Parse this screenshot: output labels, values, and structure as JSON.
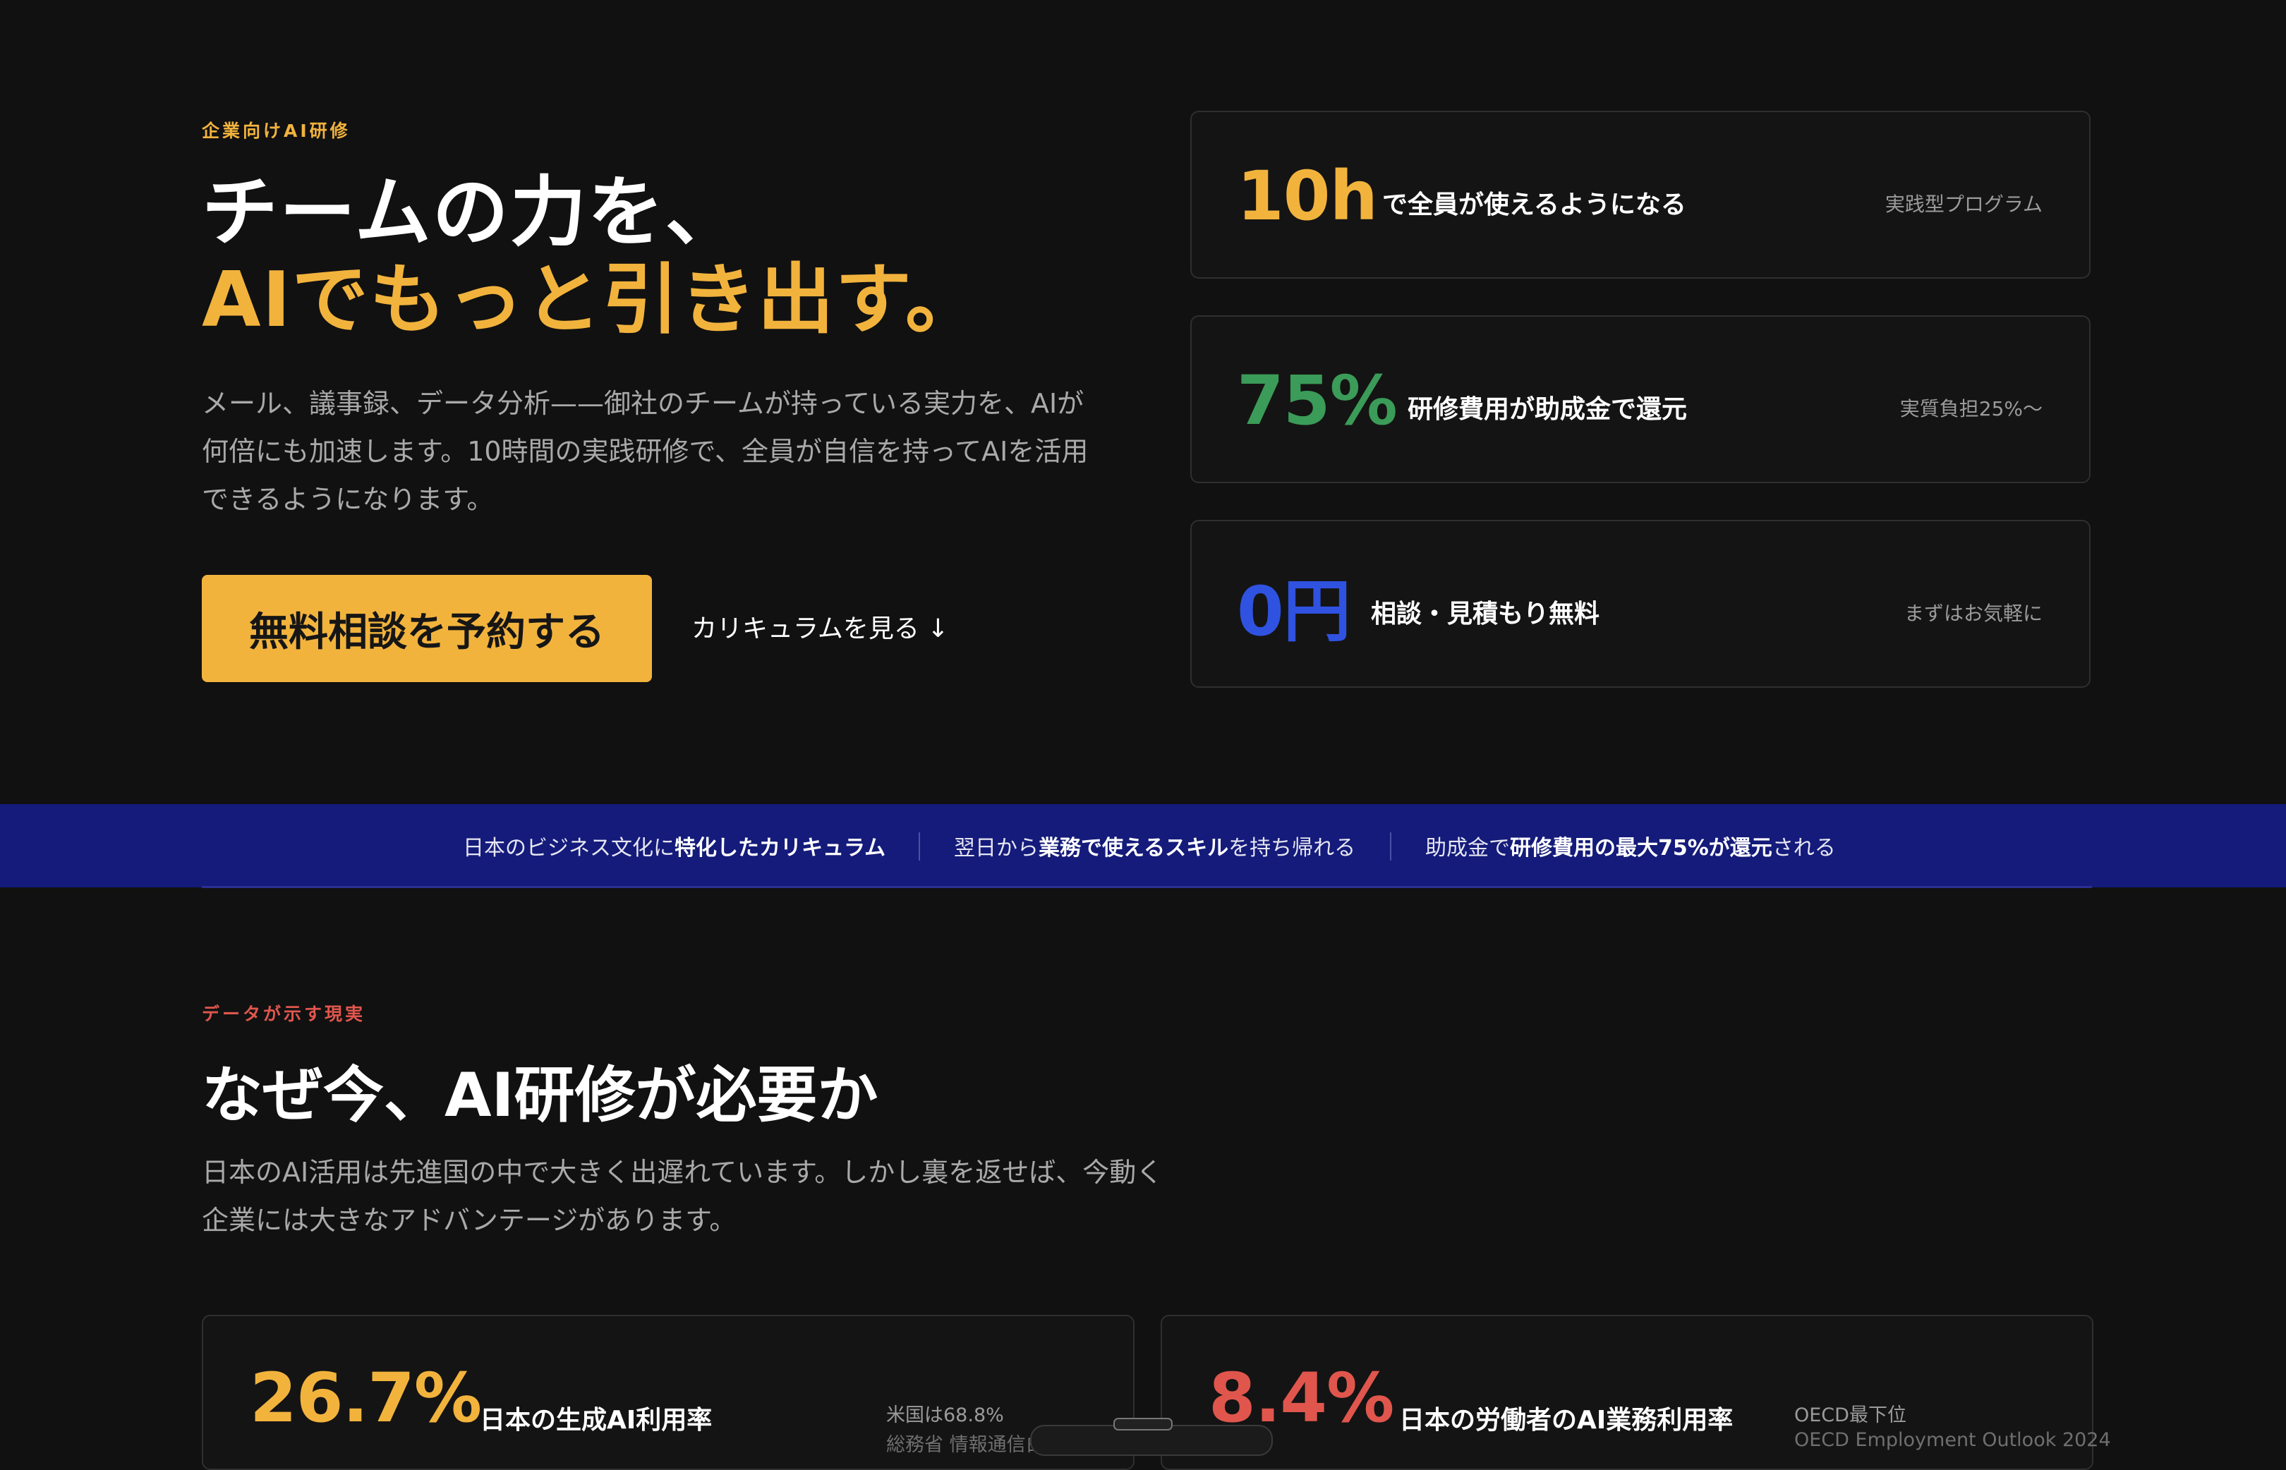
{
  "hero": {
    "eyebrow": "企業向けAI研修",
    "title_line1": "チームの力を、",
    "title_line2": "AIでもっと引き出す。",
    "lead": "メール、議事録、データ分析——御社のチームが持っている実力を、AIが何倍にも加速します。10時間の実践研修で、全員が自信を持ってAIを活用できるようになります。",
    "cta_label": "無料相談を予約する",
    "curriculum_link": "カリキュラムを見る ↓"
  },
  "stats": [
    {
      "value": "10h",
      "desc": "で全員が使えるようになる",
      "note": "実践型プログラム",
      "color": "#f2b33d"
    },
    {
      "value": "75%",
      "desc": "研修費用が助成金で還元",
      "note": "実質負担25%〜",
      "color": "#3b9b58"
    },
    {
      "value": "0円",
      "desc": "相談・見積もり無料",
      "note": "まずはお気軽に",
      "color": "#2f52e0"
    }
  ],
  "band": {
    "item1_pre": "日本のビジネス文化に",
    "item1_bold": "特化したカリキュラム",
    "item2_pre": "翌日から",
    "item2_bold": "業務で使えるスキル",
    "item2_post": "を持ち帰れる",
    "item3_pre": "助成金で",
    "item3_bold": "研修費用の最大75%が還元",
    "item3_post": "される"
  },
  "why": {
    "eyebrow": "データが示す現実",
    "title": "なぜ今、AI研修が必要か",
    "lead": "日本のAI活用は先進国の中で大きく出遅れています。しかし裏を返せば、今動く企業には大きなアドバンテージがあります。"
  },
  "data_cards": [
    {
      "value": "26.7%",
      "desc": "日本の生成AI利用率",
      "note": "米国は68.8%",
      "source": "総務省 情報通信白書",
      "color": "#f2b33d"
    },
    {
      "value": "8.4%",
      "desc": "日本の労働者のAI業務利用率",
      "note": "OECD最下位",
      "source": "OECD Employment Outlook 2024",
      "color": "#e0564d"
    }
  ]
}
